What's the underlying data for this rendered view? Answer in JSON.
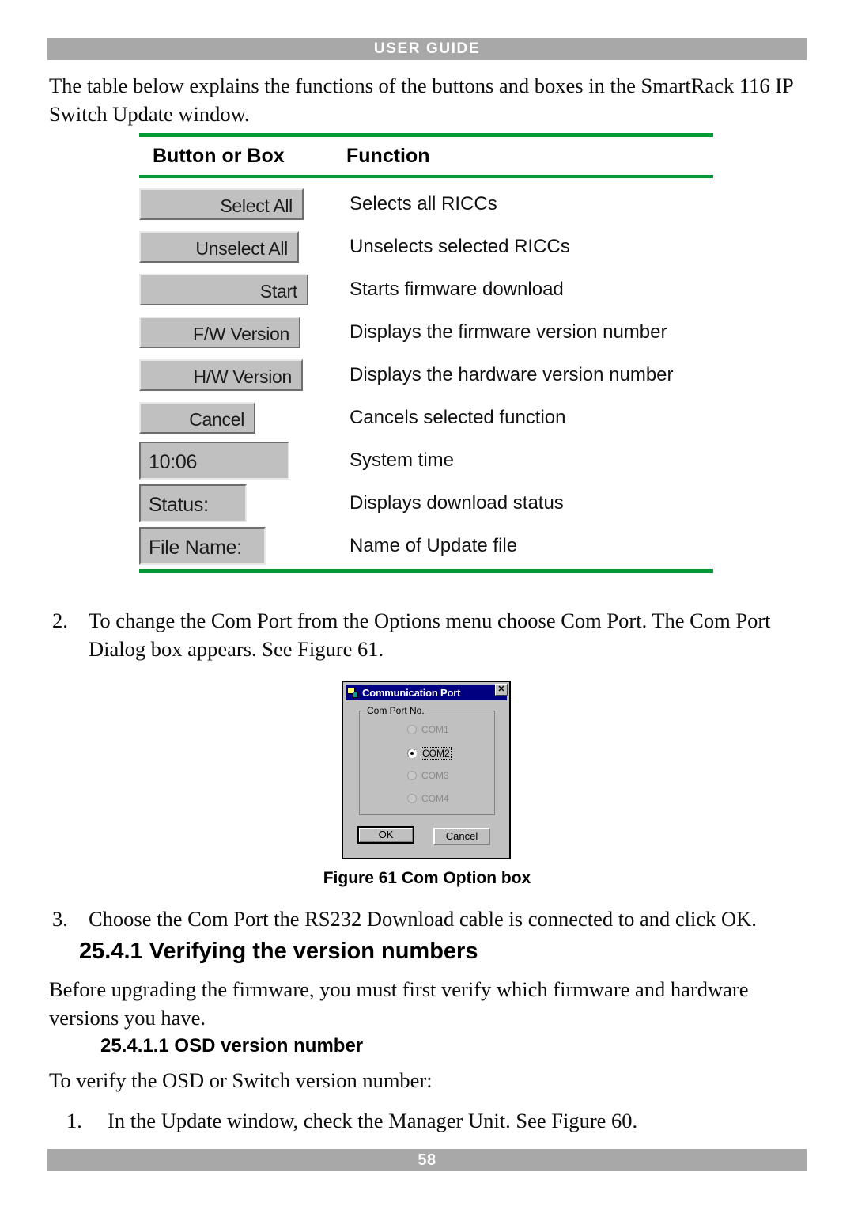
{
  "header": {
    "title": "USER GUIDE"
  },
  "footer": {
    "page_number": "58"
  },
  "intro": {
    "text": "The table below explains the functions of the buttons and boxes in the SmartRack 116 IP Switch Update window."
  },
  "table": {
    "columns": [
      "Button or Box",
      "Function"
    ],
    "accent_color": "#009933",
    "rows": [
      {
        "widget": "Select All",
        "widget_type": "button",
        "function": "Selects all RICCs"
      },
      {
        "widget": "Unselect All",
        "widget_type": "button",
        "function": "Unselects selected RICCs"
      },
      {
        "widget": "Start",
        "widget_type": "button",
        "function": "Starts firmware download"
      },
      {
        "widget": "F/W Version",
        "widget_type": "button",
        "function": "Displays the firmware version number"
      },
      {
        "widget": "H/W Version",
        "widget_type": "button",
        "function": "Displays the hardware version number"
      },
      {
        "widget": "Cancel",
        "widget_type": "button",
        "function": "Cancels selected function"
      },
      {
        "widget": "10:06",
        "widget_type": "field",
        "function": "System time"
      },
      {
        "widget": "Status:",
        "widget_type": "field",
        "function": "Displays download status"
      },
      {
        "widget": "File Name:",
        "widget_type": "field",
        "function": "Name of Update file"
      }
    ]
  },
  "steps": {
    "step2_num": "2.",
    "step2_text": "To change the Com Port from the Options menu choose Com Port. The Com Port Dialog box appears. See Figure 61.",
    "step3_num": "3.",
    "step3_text": "Choose the Com Port the RS232 Download cable is connected to and click OK.",
    "step1b_num": "1.",
    "step1b_text": "In the Update window, check the Manager Unit. See Figure 60."
  },
  "figure": {
    "caption": "Figure 61 Com Option box",
    "dialog": {
      "title": "Communication Port",
      "titlebar_color": "#000080",
      "close_label": "✕",
      "group_label": "Com Port No.",
      "options": [
        {
          "label": "COM1",
          "selected": false,
          "enabled": false
        },
        {
          "label": "COM2",
          "selected": true,
          "enabled": true
        },
        {
          "label": "COM3",
          "selected": false,
          "enabled": false
        },
        {
          "label": "COM4",
          "selected": false,
          "enabled": false
        }
      ],
      "ok_label": "OK",
      "cancel_label": "Cancel"
    }
  },
  "headings": {
    "h2541": "25.4.1 Verifying the version numbers",
    "h25411": "25.4.1.1 OSD version number"
  },
  "paragraphs": {
    "before_upgrading": "Before upgrading the firmware, you must first verify which firmware and hardware versions you have.",
    "to_verify": "To verify the OSD or Switch version number:"
  }
}
